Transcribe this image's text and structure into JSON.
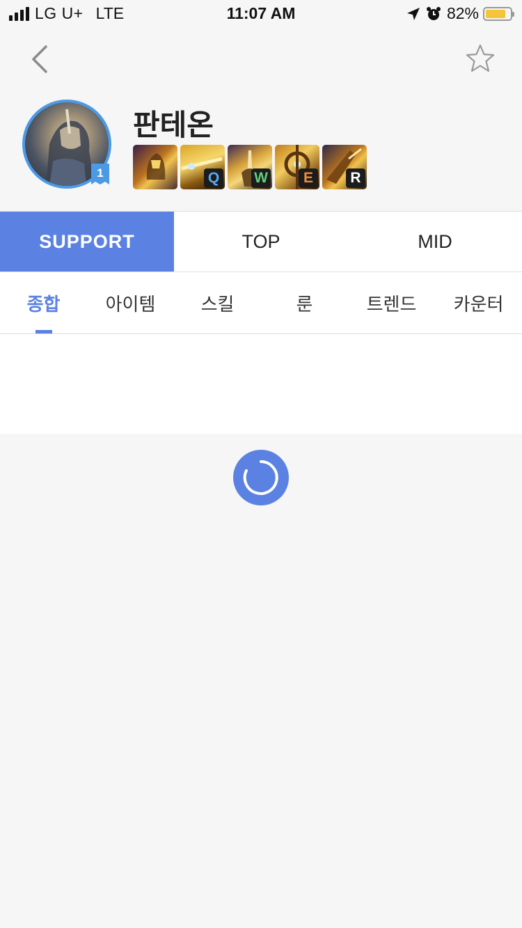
{
  "status_bar": {
    "carrier": "LG U+",
    "network": "LTE",
    "time": "11:07 AM",
    "battery_percent": "82%",
    "battery_level": 0.82,
    "icons": [
      "signal-icon",
      "location-arrow-icon",
      "alarm-icon",
      "battery-icon"
    ]
  },
  "header": {
    "back_icon": "chevron-left-icon",
    "favorite_icon": "star-outline-icon"
  },
  "champion": {
    "name": "판테온",
    "rank_badge": "1",
    "skills": [
      {
        "key": "",
        "kind": "passive"
      },
      {
        "key": "Q",
        "kind": "q"
      },
      {
        "key": "W",
        "kind": "w"
      },
      {
        "key": "E",
        "kind": "e"
      },
      {
        "key": "R",
        "kind": "r"
      }
    ]
  },
  "role_tabs": [
    {
      "label": "SUPPORT",
      "active": true
    },
    {
      "label": "TOP",
      "active": false
    },
    {
      "label": "MID",
      "active": false
    }
  ],
  "sub_tabs": [
    {
      "label": "종합",
      "active": true
    },
    {
      "label": "아이템",
      "active": false
    },
    {
      "label": "스킬",
      "active": false
    },
    {
      "label": "룬",
      "active": false
    },
    {
      "label": "트렌드",
      "active": false
    },
    {
      "label": "카운터",
      "active": false
    }
  ],
  "colors": {
    "accent": "#5b82e2",
    "avatar_ring": "#4c9ae6",
    "battery_fill": "#f5c438"
  }
}
